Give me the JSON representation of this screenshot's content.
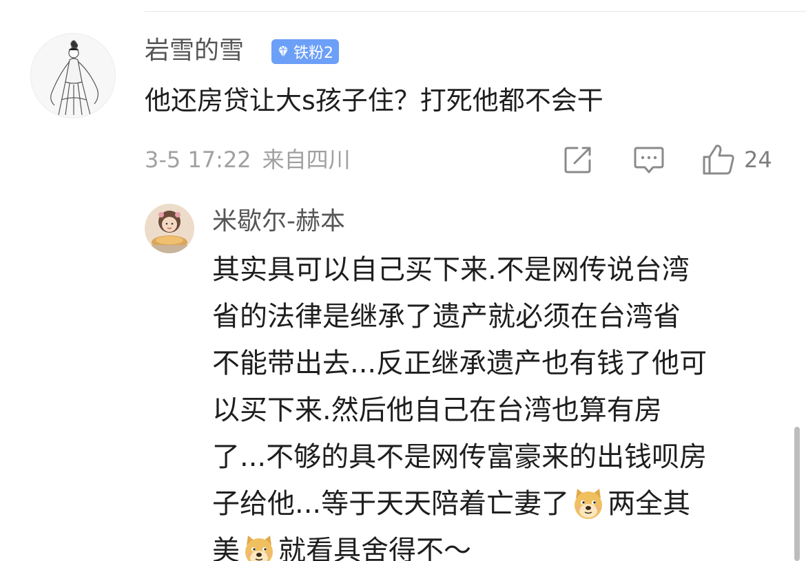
{
  "main_comment": {
    "username": "岩雪的雪",
    "badge": {
      "label": "铁粉2",
      "icon": "diamond-icon",
      "color": "#6c9ff7"
    },
    "text": "他还房贷让大s孩子住？打死他都不会干",
    "timestamp": "3-5 17:22",
    "location": "来自四川",
    "actions": {
      "share_icon": "share-edit-icon",
      "comment_icon": "comment-icon",
      "like_icon": "thumbs-up-icon",
      "like_count": "24"
    }
  },
  "reply": {
    "username": "米歇尔-赫本",
    "lines": [
      {
        "segments": [
          {
            "t": "其实具可以自己买下来.不是网传说台湾"
          }
        ]
      },
      {
        "segments": [
          {
            "t": "省的法律是继承了遗产就必须在台湾省"
          }
        ]
      },
      {
        "segments": [
          {
            "t": "不能带出去...反正继承遗产也有钱了他可"
          }
        ]
      },
      {
        "segments": [
          {
            "t": "以买下来.然后他自己在台湾也算有房"
          }
        ]
      },
      {
        "segments": [
          {
            "t": "了...不够的具不是网传富豪来的出钱呗房"
          }
        ]
      },
      {
        "segments": [
          {
            "t": "子给他...等于天天陪着亡妻了"
          },
          {
            "emoji": "doge-emoji"
          },
          {
            "t": "两全其"
          }
        ]
      },
      {
        "segments": [
          {
            "t": "美"
          },
          {
            "emoji": "doge-emoji"
          },
          {
            "t": "就看具舍得不～"
          }
        ]
      }
    ]
  }
}
